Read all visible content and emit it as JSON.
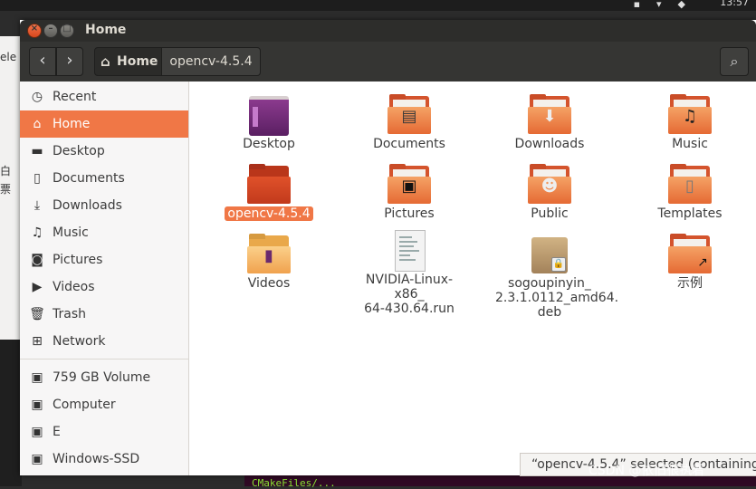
{
  "window": {
    "title": "Home"
  },
  "toolbar": {
    "back_icon": "‹",
    "forward_icon": "›",
    "breadcrumb": [
      {
        "label": "Home"
      },
      {
        "label": "opencv-4.5.4"
      }
    ],
    "search_icon": "⌕"
  },
  "sidebar": {
    "items": [
      {
        "label": "Recent",
        "icon": "clock-icon"
      },
      {
        "label": "Home",
        "icon": "home-icon",
        "active": true
      },
      {
        "label": "Desktop",
        "icon": "folder-icon"
      },
      {
        "label": "Documents",
        "icon": "document-icon"
      },
      {
        "label": "Downloads",
        "icon": "download-icon"
      },
      {
        "label": "Music",
        "icon": "music-icon"
      },
      {
        "label": "Pictures",
        "icon": "camera-icon"
      },
      {
        "label": "Videos",
        "icon": "video-icon"
      },
      {
        "label": "Trash",
        "icon": "trash-icon"
      },
      {
        "label": "Network",
        "icon": "network-icon"
      },
      {
        "label": "759 GB Volume",
        "icon": "drive-icon"
      },
      {
        "label": "Computer",
        "icon": "computer-icon"
      },
      {
        "label": "E",
        "icon": "drive-icon"
      },
      {
        "label": "Windows-SSD",
        "icon": "drive-icon"
      }
    ]
  },
  "files": [
    {
      "name": "Desktop",
      "type": "desktop-folder"
    },
    {
      "name": "Documents",
      "type": "documents-folder"
    },
    {
      "name": "Downloads",
      "type": "downloads-folder"
    },
    {
      "name": "Music",
      "type": "music-folder"
    },
    {
      "name": "opencv-4.5.4",
      "type": "folder",
      "selected": true
    },
    {
      "name": "Pictures",
      "type": "pictures-folder"
    },
    {
      "name": "Public",
      "type": "public-folder"
    },
    {
      "name": "Templates",
      "type": "templates-folder"
    },
    {
      "name": "Videos",
      "type": "videos-folder"
    },
    {
      "name": "NVIDIA-Linux-x86_\n64-430.64.run",
      "type": "script-file"
    },
    {
      "name": "sogoupinyin_\n2.3.1.0112_amd64.\ndeb",
      "type": "deb-package"
    },
    {
      "name": "示例",
      "type": "link-folder"
    }
  ],
  "status": {
    "text": "“opencv-4.5.4” selected (containing 1"
  },
  "watermark": {
    "text": "CSDN @依旧很执着"
  },
  "background": {
    "left_frags": [
      "ele",
      "白",
      "票"
    ],
    "clock": "13:57"
  },
  "colors": {
    "accent": "#f07746",
    "titlebar": "#2d2d2b",
    "toolbar": "#353533"
  }
}
